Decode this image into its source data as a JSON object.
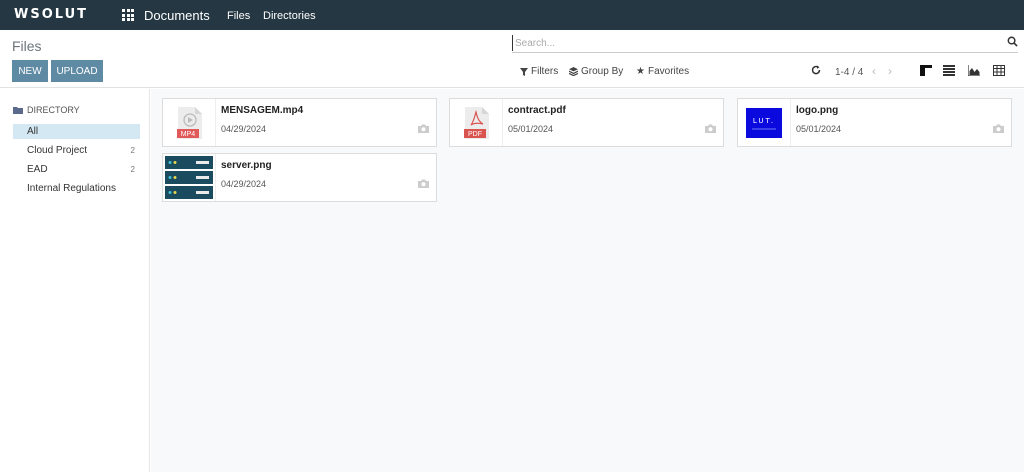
{
  "topbar": {
    "brand": "WSOLUT",
    "app_name": "Documents",
    "nav": [
      "Files",
      "Directories"
    ]
  },
  "control_panel": {
    "title": "Files",
    "new_label": "NEW",
    "upload_label": "UPLOAD",
    "search_placeholder": "Search...",
    "filters_label": "Filters",
    "groupby_label": "Group By",
    "favorites_label": "Favorites",
    "pager": "1-4 / 4"
  },
  "sidebar": {
    "header": "DIRECTORY",
    "items": [
      {
        "label": "All",
        "count": ""
      },
      {
        "label": "Cloud Project",
        "count": "2"
      },
      {
        "label": "EAD",
        "count": "2"
      },
      {
        "label": "Internal Regulations",
        "count": ""
      }
    ]
  },
  "files": [
    {
      "name": "MENSAGEM.mp4",
      "date": "04/29/2024",
      "type": "MP4"
    },
    {
      "name": "contract.pdf",
      "date": "05/01/2024",
      "type": "PDF"
    },
    {
      "name": "logo.png",
      "date": "05/01/2024",
      "type": "image",
      "thumb_text": "LUT."
    },
    {
      "name": "server.png",
      "date": "04/29/2024",
      "type": "image"
    }
  ],
  "colors": {
    "topbar": "#243742",
    "button": "#5f8aa3",
    "active_dir": "#d3e8f3",
    "pdf_red": "#d9534f",
    "logo_blue": "#0a0adf",
    "server_teal": "#1b4b5f"
  }
}
